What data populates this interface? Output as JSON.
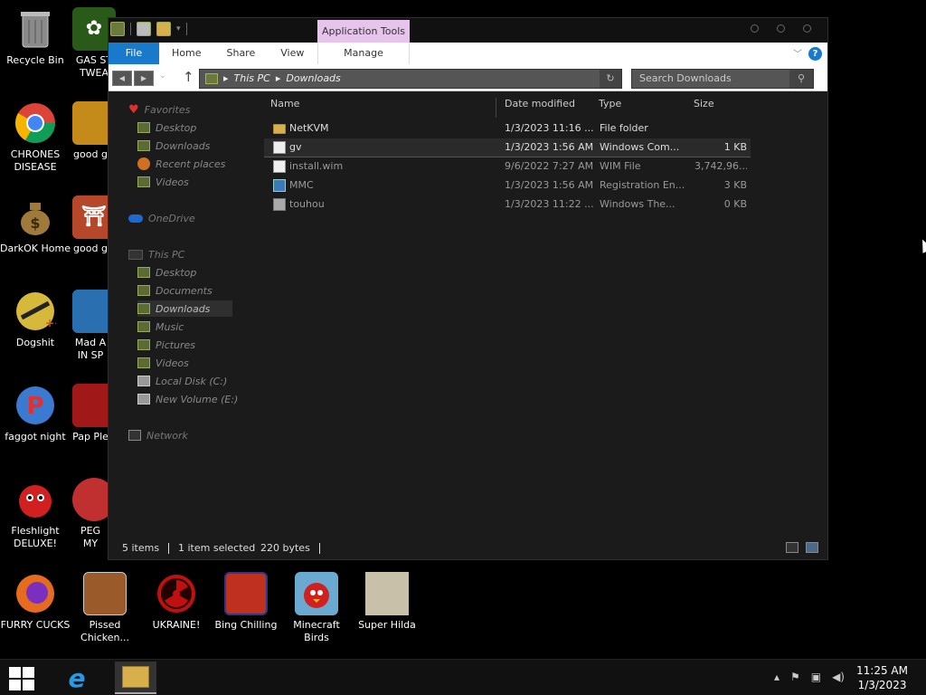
{
  "desktop": {
    "icons": [
      {
        "label": "Recycle Bin",
        "icon": "recycle-bin-icon",
        "color": "#777777"
      },
      {
        "label": "GAS ST TWEA",
        "icon": "flower-app-icon",
        "color": "#2a5a1a"
      },
      {
        "label": "CHRONES DISEASE",
        "icon": "chrome-icon",
        "color": "#db4437"
      },
      {
        "label": "good g",
        "icon": "app-icon",
        "color": "#c58b1a"
      },
      {
        "label": "DarkOK Home",
        "icon": "money-bag-icon",
        "color": "#8a6a2a"
      },
      {
        "label": "good g",
        "icon": "shrine-icon",
        "color": "#b5482a"
      },
      {
        "label": "Dogshit",
        "icon": "codeblocks-icon",
        "color": "#c8a020"
      },
      {
        "label": "Mad A IN SP",
        "icon": "game-icon",
        "color": "#2a6fb0"
      },
      {
        "label": "faggot night",
        "icon": "p-logo-icon",
        "color": "#3a7ad0"
      },
      {
        "label": "Pap Ple",
        "icon": "game-icon",
        "color": "#a01818"
      },
      {
        "label": "Fleshlight DELUXE!",
        "icon": "red-creature-icon",
        "color": "#d02020"
      },
      {
        "label": "PEG MY",
        "icon": "app-icon",
        "color": "#c03030"
      },
      {
        "label": "FURRY CUCKS",
        "icon": "firefox-icon",
        "color": "#e56b1f"
      },
      {
        "label": "Pissed Chicken...",
        "icon": "angry-birds-seasons-icon",
        "color": "#9a5a2a"
      },
      {
        "label": "UKRAINE!",
        "icon": "radiation-icon",
        "color": "#c01010"
      },
      {
        "label": "Bing Chilling",
        "icon": "box-icon",
        "color": "#c03020"
      },
      {
        "label": "Minecraft Birds",
        "icon": "angry-bird-icon",
        "color": "#d02020"
      },
      {
        "label": "Super Hilda",
        "icon": "pixel-game-icon",
        "color": "#c8c0a8"
      }
    ]
  },
  "window": {
    "context_tab": "Application Tools",
    "ribbon": {
      "file": "File",
      "home": "Home",
      "share": "Share",
      "view": "View",
      "manage": "Manage"
    },
    "address": {
      "segments": [
        "This PC",
        "Downloads"
      ]
    },
    "search": {
      "placeholder": "Search Downloads"
    },
    "nav": {
      "favorites": "Favorites",
      "desktop1": "Desktop",
      "downloads1": "Downloads",
      "recent": "Recent places",
      "videos1": "Videos",
      "onedrive": "OneDrive",
      "thispc": "This PC",
      "desktop2": "Desktop",
      "documents": "Documents",
      "downloads2": "Downloads",
      "music": "Music",
      "pictures": "Pictures",
      "videos2": "Videos",
      "localdisk": "Local Disk (C:)",
      "newvolume": "New Volume (E:)",
      "network": "Network"
    },
    "columns": {
      "name": "Name",
      "date": "Date modified",
      "type": "Type",
      "size": "Size"
    },
    "files": [
      {
        "name": "NetKVM",
        "date": "1/3/2023 11:16 ...",
        "type": "File folder",
        "size": "",
        "icon": "folder-icon"
      },
      {
        "name": "gv",
        "date": "1/3/2023 1:56 AM",
        "type": "Windows Com...",
        "size": "1 KB",
        "icon": "windows-command-icon"
      },
      {
        "name": "install.wim",
        "date": "9/6/2022 7:27 AM",
        "type": "WIM File",
        "size": "3,742,96...",
        "icon": "file-icon"
      },
      {
        "name": "MMC",
        "date": "1/3/2023 1:56 AM",
        "type": "Registration En...",
        "size": "3 KB",
        "icon": "registry-icon"
      },
      {
        "name": "touhou",
        "date": "1/3/2023 11:22 ...",
        "type": "Windows The...",
        "size": "0 KB",
        "icon": "theme-icon"
      }
    ],
    "status": {
      "count": "5 items",
      "selected": "1 item selected",
      "bytes": "220 bytes"
    }
  },
  "taskbar": {
    "time": "11:25 AM",
    "date": "1/3/2023"
  }
}
